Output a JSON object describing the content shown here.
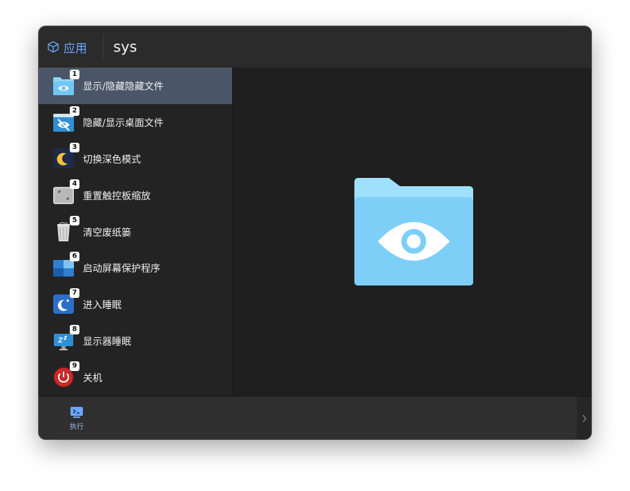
{
  "search": {
    "app_label": "应用",
    "query": "sys"
  },
  "results": [
    {
      "num": "1",
      "label": "显示/隐藏隐藏文件",
      "icon": "show-hidden-files-icon",
      "selected": true
    },
    {
      "num": "2",
      "label": "隐藏/显示桌面文件",
      "icon": "hide-desktop-files-icon"
    },
    {
      "num": "3",
      "label": "切换深色模式",
      "icon": "dark-mode-moon-icon"
    },
    {
      "num": "4",
      "label": "重置触控板缩放",
      "icon": "trackpad-zoom-reset-icon"
    },
    {
      "num": "5",
      "label": "清空废纸篓",
      "icon": "trash-icon"
    },
    {
      "num": "6",
      "label": "启动屏幕保护程序",
      "icon": "screensaver-icon"
    },
    {
      "num": "7",
      "label": "进入睡眠",
      "icon": "sleep-moon-icon"
    },
    {
      "num": "8",
      "label": "显示器睡眠",
      "icon": "display-sleep-icon"
    },
    {
      "num": "9",
      "label": "关机",
      "icon": "power-icon"
    }
  ],
  "preview": {
    "icon": "eye-folder-icon"
  },
  "footer": {
    "execute_label": "执行",
    "execute_icon": "terminal-icon",
    "next_icon": "chevron-right-icon"
  },
  "colors": {
    "accent": "#6aa7ff",
    "selected_row": "#4a5567",
    "folder": "#7dcff8"
  }
}
